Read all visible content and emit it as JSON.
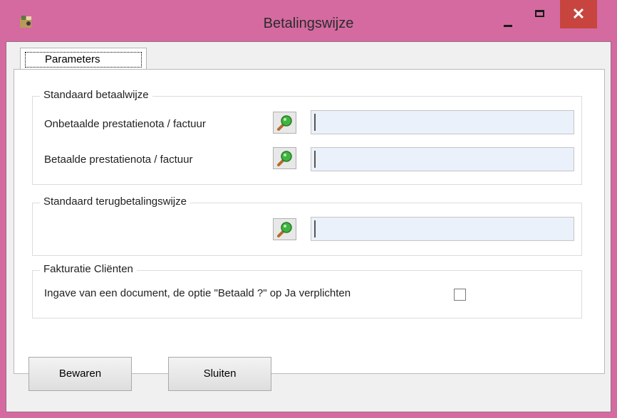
{
  "window": {
    "title": "Betalingswijze",
    "app_icon": "app-icon",
    "close_symbol": "✕"
  },
  "tabs": [
    {
      "label": "Parameters",
      "selected": true
    }
  ],
  "groups": {
    "standard_payment": {
      "title": "Standaard betaalwijze",
      "rows": [
        {
          "label": "Onbetaalde prestatienota / factuur",
          "value": ""
        },
        {
          "label": "Betaalde prestatienota / factuur",
          "value": ""
        }
      ]
    },
    "standard_refund": {
      "title": "Standaard terugbetalingswijze",
      "value": ""
    },
    "client_invoicing": {
      "title": "Fakturatie Cliënten",
      "checkbox_label": "Ingave van een document, de optie \"Betaald ?\" op Ja verplichten",
      "checked": false
    }
  },
  "buttons": {
    "save": "Bewaren",
    "close": "Sluiten"
  },
  "colors": {
    "frame": "#d46aa0",
    "close_button": "#c7453e",
    "field_bg": "#eaf1fb"
  }
}
